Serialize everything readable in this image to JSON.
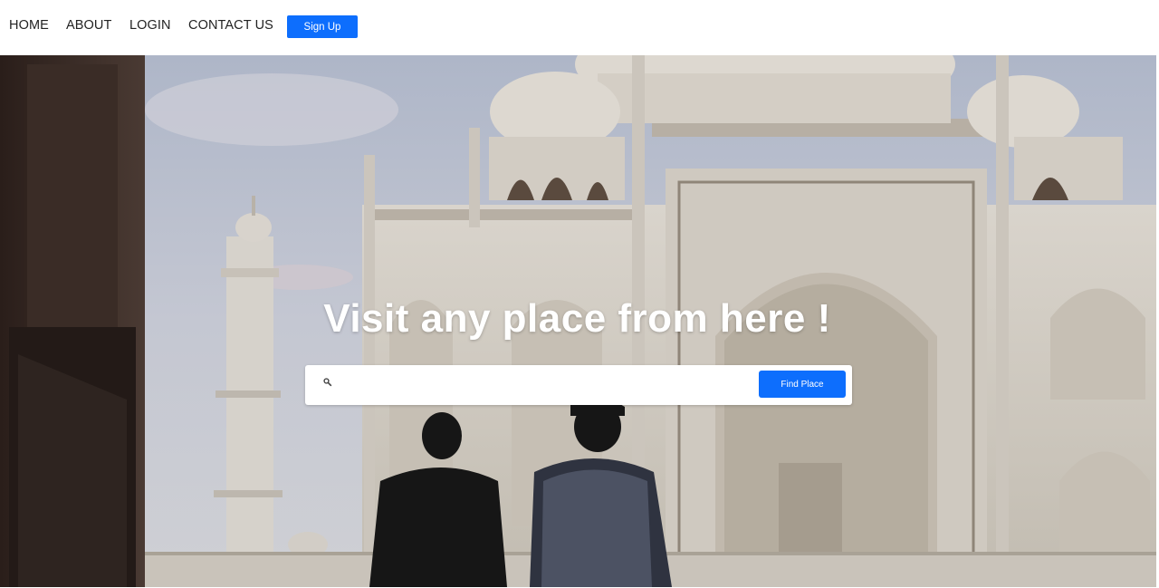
{
  "nav": {
    "home": "HOME",
    "about": "ABOUT",
    "login": "LOGIN",
    "contact": "CONTACT US",
    "signup": "Sign Up"
  },
  "hero": {
    "title": "Visit any place from here !",
    "background": "taj-mahal-photo",
    "search": {
      "icon": "search-icon",
      "placeholder": "",
      "value": "",
      "button": "Find Place"
    }
  },
  "colors": {
    "accent": "#0d6efd",
    "nav_text": "#222222",
    "hero_text": "#ffffff"
  }
}
